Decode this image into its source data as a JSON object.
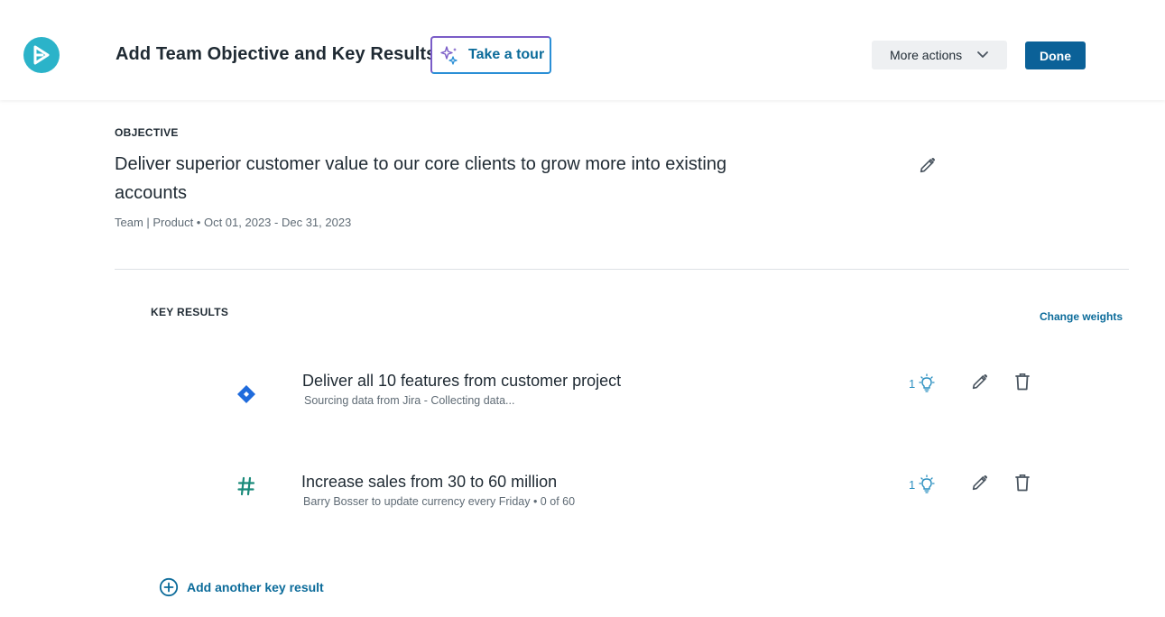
{
  "header": {
    "title": "Add Team Objective and Key Results",
    "tour_label": "Take a tour",
    "more_actions_label": "More actions",
    "done_label": "Done"
  },
  "objective": {
    "section_label": "OBJECTIVE",
    "text": "Deliver superior customer value to our core clients to grow more into existing accounts",
    "meta": "Team | Product • Oct 01, 2023 - Dec 31, 2023"
  },
  "key_results": {
    "section_label": "KEY RESULTS",
    "change_weights_label": "Change weights",
    "items": [
      {
        "icon": "jira-diamond-icon",
        "title": "Deliver all 10 features from customer project",
        "subtitle": "Sourcing data from Jira - Collecting data...",
        "count": "1"
      },
      {
        "icon": "hash-icon",
        "title": "Increase sales from 30 to 60 million",
        "subtitle": "Barry Bosser to update currency every Friday  •  0 of 60",
        "count": "1"
      }
    ],
    "add_label": "Add another key result"
  },
  "colors": {
    "accent": "#0b6198",
    "link": "#0b6b9a",
    "logo": "#2bb3c9",
    "jira": "#1f6bdc",
    "hash": "#1a8a7a"
  }
}
